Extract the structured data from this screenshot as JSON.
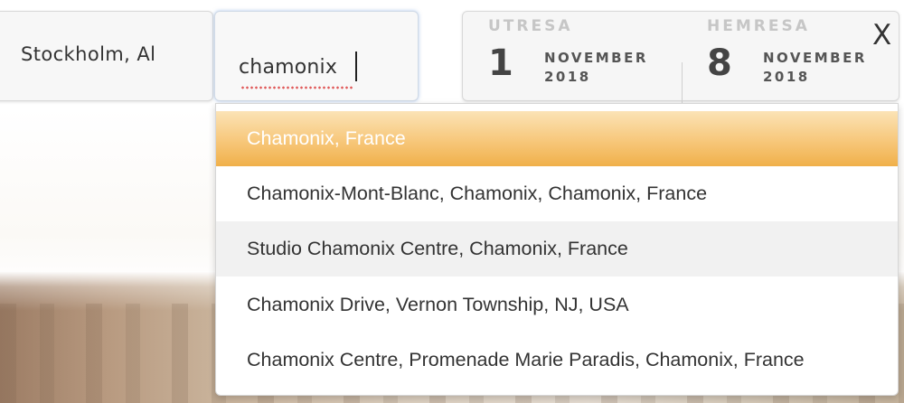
{
  "search": {
    "from_value": "Stockholm, Al",
    "to_value": "chamonix"
  },
  "dates": {
    "outbound": {
      "label": "UTRESA",
      "day": "1",
      "month": "NOVEMBER",
      "year": "2018"
    },
    "return": {
      "label": "HEMRESA",
      "day": "8",
      "month": "NOVEMBER",
      "year": "2018"
    }
  },
  "close_label": "X",
  "suggestions": [
    {
      "label": "Chamonix, France"
    },
    {
      "label": "Chamonix-Mont-Blanc, Chamonix, Chamonix, France"
    },
    {
      "label": "Studio Chamonix Centre, Chamonix, France"
    },
    {
      "label": "Chamonix Drive, Vernon Township, NJ, USA"
    },
    {
      "label": "Chamonix Centre, Promenade Marie Paradis, Chamonix, France"
    }
  ],
  "colors": {
    "highlight": "#f0b04a",
    "accent_text": "#ffffff"
  }
}
